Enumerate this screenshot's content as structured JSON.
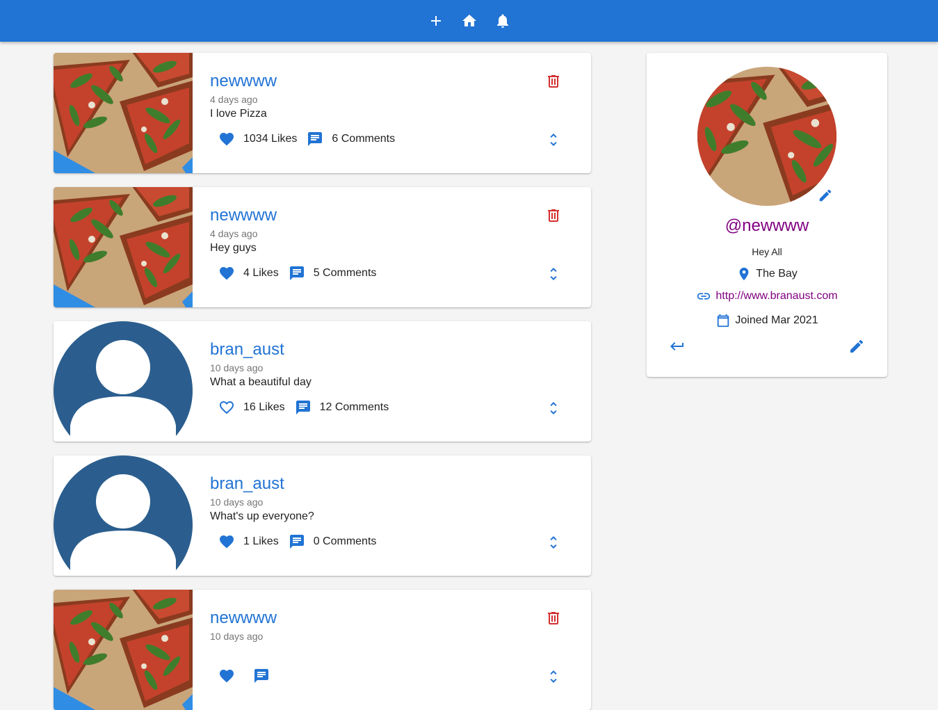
{
  "nav": {
    "items": [
      {
        "icon": "add-icon"
      },
      {
        "icon": "home-icon"
      },
      {
        "icon": "bell-icon"
      }
    ]
  },
  "posts": [
    {
      "handle": "newwww",
      "time": "4 days ago",
      "body": "I love Pizza",
      "likes": "1034 Likes",
      "comments": "6 Comments",
      "liked": true,
      "image": "pizza",
      "deletable": true
    },
    {
      "handle": "newwww",
      "time": "4 days ago",
      "body": "Hey guys",
      "likes": "4 Likes",
      "comments": "5 Comments",
      "liked": true,
      "image": "pizza",
      "deletable": true
    },
    {
      "handle": "bran_aust",
      "time": "10 days ago",
      "body": "What a beautiful day",
      "likes": "16 Likes",
      "comments": "12 Comments",
      "liked": false,
      "image": "default-avatar",
      "deletable": false
    },
    {
      "handle": "bran_aust",
      "time": "10 days ago",
      "body": "What's up everyone?",
      "likes": "1 Likes",
      "comments": "0 Comments",
      "liked": true,
      "image": "default-avatar",
      "deletable": false
    },
    {
      "handle": "newwww",
      "time": "10 days ago",
      "body": "",
      "likes": "",
      "comments": "",
      "liked": true,
      "image": "pizza",
      "deletable": true
    }
  ],
  "profile": {
    "handle": "@newwww",
    "bio": "Hey All",
    "location": "The Bay",
    "website": "http://www.branaust.com",
    "joined": "Joined Mar 2021"
  },
  "colors": {
    "primary": "#2173d4",
    "danger": "#d32f2f",
    "profile_handle": "#800080",
    "avatar_default": "#2b5e8e"
  }
}
